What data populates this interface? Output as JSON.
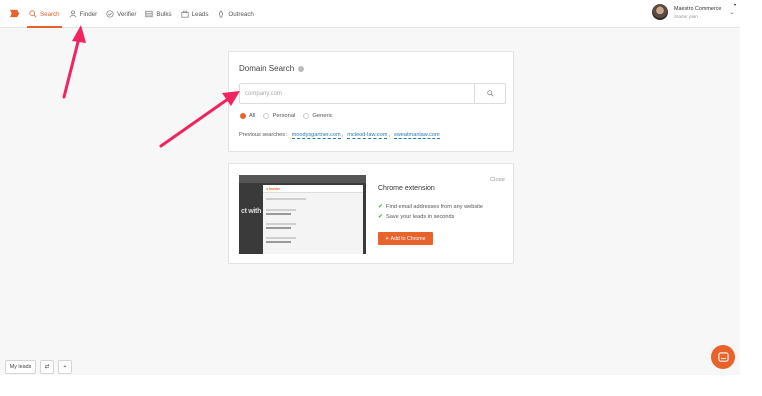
{
  "nav": {
    "items": [
      {
        "label": "Search",
        "icon": "search-icon",
        "active": true
      },
      {
        "label": "Finder",
        "icon": "finder-icon",
        "active": false
      },
      {
        "label": "Verifier",
        "icon": "verifier-icon",
        "active": false
      },
      {
        "label": "Bulks",
        "icon": "bulks-icon",
        "active": false
      },
      {
        "label": "Leads",
        "icon": "leads-icon",
        "active": false
      },
      {
        "label": "Outreach",
        "icon": "outreach-icon",
        "active": false
      }
    ]
  },
  "account": {
    "name": "Maestro Commerce",
    "plan": "Starter plan"
  },
  "domain_search": {
    "title": "Domain Search",
    "placeholder": "company.com",
    "filters": [
      {
        "label": "All",
        "checked": true
      },
      {
        "label": "Personal",
        "checked": false
      },
      {
        "label": "Generic",
        "checked": false
      }
    ],
    "previous_label": "Previous searches",
    "previous": [
      "moodysgartner.com",
      "mcleod-law.com",
      "sweatmanlaw.com"
    ]
  },
  "chrome_ext": {
    "title": "Chrome extension",
    "close": "Close",
    "features": [
      "Find email addresses from any website",
      "Save your leads in seconds"
    ],
    "button": "Add to Chrome"
  },
  "bottom": {
    "my_leads": "My leads",
    "swap": "⇄",
    "add": "+"
  },
  "colors": {
    "accent": "#e8622c",
    "link": "#2a7ab8",
    "check": "#3fae49",
    "annotation_arrow": "#f0245e"
  }
}
